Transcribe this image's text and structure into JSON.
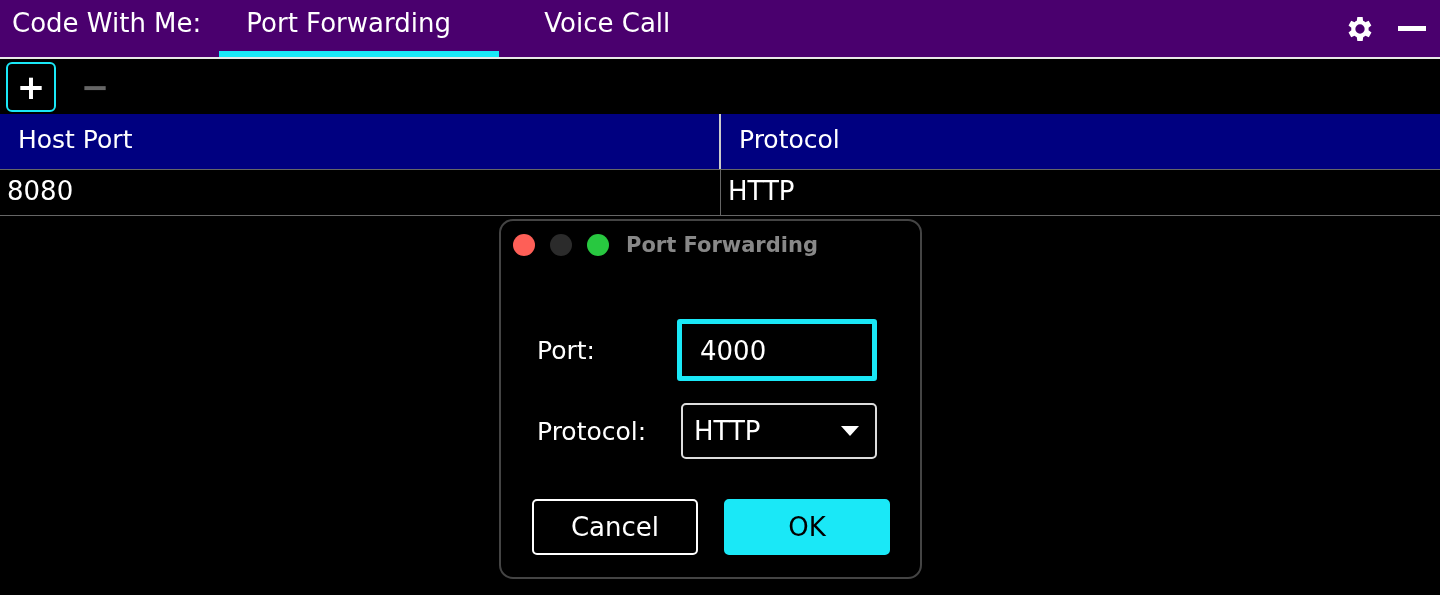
{
  "header": {
    "label": "Code With Me:",
    "tabs": [
      {
        "label": "Port Forwarding",
        "selected": true
      },
      {
        "label": "Voice Call",
        "selected": false
      }
    ]
  },
  "toolbar": [
    {
      "label": "+",
      "disabled": false,
      "focused": true
    },
    {
      "label": "−",
      "disabled": true,
      "focused": false
    }
  ],
  "table": {
    "columns": [
      "Host Port",
      "Protocol"
    ],
    "rows": [
      [
        "8080",
        "HTTP"
      ]
    ]
  },
  "dialog": {
    "title": "Port Forwarding",
    "window_buttons": [
      {
        "color": "#fe5f57"
      },
      {
        "color": "#2b2b2b"
      },
      {
        "color": "#28c840"
      }
    ],
    "fields": [
      {
        "kind": "input",
        "label": "Port:",
        "value": "4000",
        "focused": true
      },
      {
        "kind": "select",
        "label": "Protocol:",
        "value": "HTTP",
        "focused": false
      }
    ],
    "buttons": [
      {
        "label": "Cancel",
        "kind": "secondary"
      },
      {
        "label": "OK",
        "kind": "primary"
      }
    ]
  }
}
